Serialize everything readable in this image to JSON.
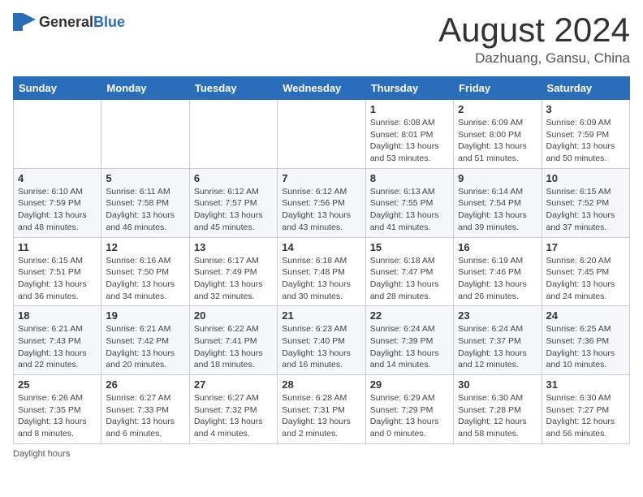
{
  "header": {
    "logo_general": "General",
    "logo_blue": "Blue",
    "title": "August 2024",
    "location": "Dazhuang, Gansu, China"
  },
  "weekdays": [
    "Sunday",
    "Monday",
    "Tuesday",
    "Wednesday",
    "Thursday",
    "Friday",
    "Saturday"
  ],
  "weeks": [
    [
      null,
      null,
      null,
      null,
      {
        "day": "1",
        "sunrise": "6:08 AM",
        "sunset": "8:01 PM",
        "daylight": "13 hours and 53 minutes."
      },
      {
        "day": "2",
        "sunrise": "6:09 AM",
        "sunset": "8:00 PM",
        "daylight": "13 hours and 51 minutes."
      },
      {
        "day": "3",
        "sunrise": "6:09 AM",
        "sunset": "7:59 PM",
        "daylight": "13 hours and 50 minutes."
      }
    ],
    [
      {
        "day": "4",
        "sunrise": "6:10 AM",
        "sunset": "7:59 PM",
        "daylight": "13 hours and 48 minutes."
      },
      {
        "day": "5",
        "sunrise": "6:11 AM",
        "sunset": "7:58 PM",
        "daylight": "13 hours and 46 minutes."
      },
      {
        "day": "6",
        "sunrise": "6:12 AM",
        "sunset": "7:57 PM",
        "daylight": "13 hours and 45 minutes."
      },
      {
        "day": "7",
        "sunrise": "6:12 AM",
        "sunset": "7:56 PM",
        "daylight": "13 hours and 43 minutes."
      },
      {
        "day": "8",
        "sunrise": "6:13 AM",
        "sunset": "7:55 PM",
        "daylight": "13 hours and 41 minutes."
      },
      {
        "day": "9",
        "sunrise": "6:14 AM",
        "sunset": "7:54 PM",
        "daylight": "13 hours and 39 minutes."
      },
      {
        "day": "10",
        "sunrise": "6:15 AM",
        "sunset": "7:52 PM",
        "daylight": "13 hours and 37 minutes."
      }
    ],
    [
      {
        "day": "11",
        "sunrise": "6:15 AM",
        "sunset": "7:51 PM",
        "daylight": "13 hours and 36 minutes."
      },
      {
        "day": "12",
        "sunrise": "6:16 AM",
        "sunset": "7:50 PM",
        "daylight": "13 hours and 34 minutes."
      },
      {
        "day": "13",
        "sunrise": "6:17 AM",
        "sunset": "7:49 PM",
        "daylight": "13 hours and 32 minutes."
      },
      {
        "day": "14",
        "sunrise": "6:18 AM",
        "sunset": "7:48 PM",
        "daylight": "13 hours and 30 minutes."
      },
      {
        "day": "15",
        "sunrise": "6:18 AM",
        "sunset": "7:47 PM",
        "daylight": "13 hours and 28 minutes."
      },
      {
        "day": "16",
        "sunrise": "6:19 AM",
        "sunset": "7:46 PM",
        "daylight": "13 hours and 26 minutes."
      },
      {
        "day": "17",
        "sunrise": "6:20 AM",
        "sunset": "7:45 PM",
        "daylight": "13 hours and 24 minutes."
      }
    ],
    [
      {
        "day": "18",
        "sunrise": "6:21 AM",
        "sunset": "7:43 PM",
        "daylight": "13 hours and 22 minutes."
      },
      {
        "day": "19",
        "sunrise": "6:21 AM",
        "sunset": "7:42 PM",
        "daylight": "13 hours and 20 minutes."
      },
      {
        "day": "20",
        "sunrise": "6:22 AM",
        "sunset": "7:41 PM",
        "daylight": "13 hours and 18 minutes."
      },
      {
        "day": "21",
        "sunrise": "6:23 AM",
        "sunset": "7:40 PM",
        "daylight": "13 hours and 16 minutes."
      },
      {
        "day": "22",
        "sunrise": "6:24 AM",
        "sunset": "7:39 PM",
        "daylight": "13 hours and 14 minutes."
      },
      {
        "day": "23",
        "sunrise": "6:24 AM",
        "sunset": "7:37 PM",
        "daylight": "13 hours and 12 minutes."
      },
      {
        "day": "24",
        "sunrise": "6:25 AM",
        "sunset": "7:36 PM",
        "daylight": "13 hours and 10 minutes."
      }
    ],
    [
      {
        "day": "25",
        "sunrise": "6:26 AM",
        "sunset": "7:35 PM",
        "daylight": "13 hours and 8 minutes."
      },
      {
        "day": "26",
        "sunrise": "6:27 AM",
        "sunset": "7:33 PM",
        "daylight": "13 hours and 6 minutes."
      },
      {
        "day": "27",
        "sunrise": "6:27 AM",
        "sunset": "7:32 PM",
        "daylight": "13 hours and 4 minutes."
      },
      {
        "day": "28",
        "sunrise": "6:28 AM",
        "sunset": "7:31 PM",
        "daylight": "13 hours and 2 minutes."
      },
      {
        "day": "29",
        "sunrise": "6:29 AM",
        "sunset": "7:29 PM",
        "daylight": "13 hours and 0 minutes."
      },
      {
        "day": "30",
        "sunrise": "6:30 AM",
        "sunset": "7:28 PM",
        "daylight": "12 hours and 58 minutes."
      },
      {
        "day": "31",
        "sunrise": "6:30 AM",
        "sunset": "7:27 PM",
        "daylight": "12 hours and 56 minutes."
      }
    ]
  ],
  "footer": {
    "daylight_label": "Daylight hours"
  }
}
